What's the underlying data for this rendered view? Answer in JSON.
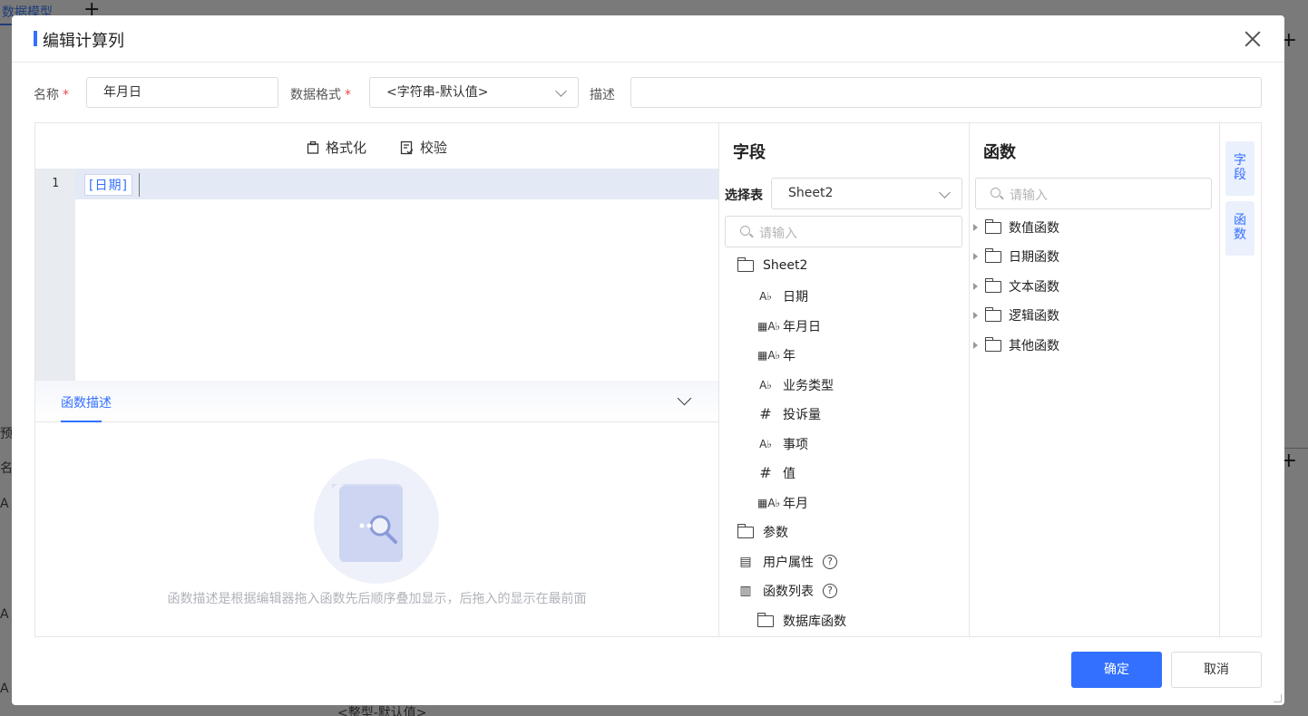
{
  "background": {
    "tab_label": "数据模型",
    "bottom_text": "<整型-默认值>",
    "left_marks": [
      "预",
      "名",
      "A",
      "A",
      "A"
    ]
  },
  "dialog": {
    "title": "编辑计算列",
    "name_label": "名称",
    "name_value": "年月日",
    "format_label": "数据格式",
    "format_value": "<字符串-默认值>",
    "desc_label": "描述",
    "desc_value": "",
    "required_mark": "*"
  },
  "editor": {
    "format_label": "格式化",
    "validate_label": "校验",
    "line_number": "1",
    "token": "[日期]",
    "desc_tab": "函数描述",
    "empty_text": "函数描述是根据编辑器拖入函数先后顺序叠加显示，后拖入的显示在最前面"
  },
  "fields_panel": {
    "title": "字段",
    "table_label": "选择表",
    "table_value": "Sheet2",
    "search_placeholder": "请输入",
    "tree": [
      {
        "label": "Sheet2",
        "icon": "folder-open-icon"
      },
      {
        "label": "日期",
        "icon": "text-field-icon",
        "glyph": "A♭"
      },
      {
        "label": "年月日",
        "icon": "date-text-field-icon",
        "glyph": "▦A♭"
      },
      {
        "label": "年",
        "icon": "date-text-field-icon",
        "glyph": "▦A♭"
      },
      {
        "label": "业务类型",
        "icon": "text-field-icon",
        "glyph": "A♭"
      },
      {
        "label": "投诉量",
        "icon": "number-field-icon",
        "glyph": "#"
      },
      {
        "label": "事项",
        "icon": "text-field-icon",
        "glyph": "A♭"
      },
      {
        "label": "值",
        "icon": "number-field-icon",
        "glyph": "#"
      },
      {
        "label": "年月",
        "icon": "date-text-field-icon",
        "glyph": "▦A♭"
      },
      {
        "label": "参数",
        "icon": "folder-open-icon"
      },
      {
        "label": "用户属性",
        "icon": "user-attribute-icon",
        "help": "?"
      },
      {
        "label": "函数列表",
        "icon": "function-list-icon",
        "help": "?"
      },
      {
        "label": "数据库函数",
        "icon": "folder-icon"
      }
    ]
  },
  "functions_panel": {
    "title": "函数",
    "search_placeholder": "请输入",
    "items": [
      "数值函数",
      "日期函数",
      "文本函数",
      "逻辑函数",
      "其他函数"
    ]
  },
  "side_tabs": [
    "字段",
    "函数"
  ],
  "buttons": {
    "ok": "确定",
    "cancel": "取消"
  },
  "colors": {
    "accent": "#3370ff",
    "overlay": "#7a7a7a"
  }
}
